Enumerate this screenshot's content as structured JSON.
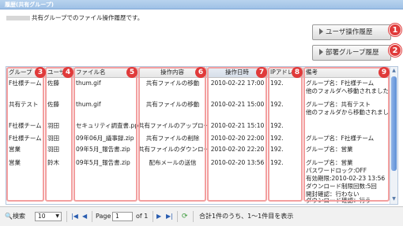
{
  "title": "履歴(共有グループ)",
  "description": "共有グループでのファイル操作履歴です。",
  "buttons": {
    "user_history": "ユーザ操作履歴",
    "dept_history": "部署グループ履歴"
  },
  "badges": [
    "1",
    "2",
    "3",
    "4",
    "5",
    "6",
    "7",
    "8",
    "9"
  ],
  "columns": [
    "グループ",
    "ユーザ",
    "ファイル名",
    "操作内容",
    "操作日時",
    "IPアドレス",
    "備考"
  ],
  "rows": [
    {
      "group": "F社様チーム",
      "user": "佐藤",
      "file": "thum.gif",
      "op": "共有ファイルの移動",
      "time": "2010-02-22 17:00",
      "ip": "192.",
      "note": [
        "グループ名：F社様チーム",
        "他のフォルダへ移動されました。"
      ]
    },
    {
      "group": "共有テスト",
      "user": "佐藤",
      "file": "thum.gif",
      "op": "共有ファイルの移動",
      "time": "2010-02-21 15:00",
      "ip": "192.",
      "note": [
        "グループ名：共有テスト",
        "他のフォルダから移動されました。"
      ]
    },
    {
      "group": "F社様チーム",
      "user": "羽田",
      "file": "セキュリティ調査書.ppt",
      "op": "共有ファイルのアップロード",
      "time": "2010-02-21 15:10",
      "ip": "192.",
      "note": []
    },
    {
      "group": "F社様チーム",
      "user": "羽田",
      "file": "09年06月_議事録.zip",
      "op": "共有ファイルの削除",
      "time": "2010-02-20 22:00",
      "ip": "192.",
      "note": [
        "グループ名：F社様チーム"
      ]
    },
    {
      "group": "営業",
      "user": "羽田",
      "file": "09年5月_報告書.zip",
      "op": "共有ファイルのダウンロード",
      "time": "2010-02-20 22:20",
      "ip": "192.",
      "note": [
        "グループ名：営業"
      ]
    },
    {
      "group": "営業",
      "user": "鈴木",
      "file": "09年5月_報告書.zip",
      "op": "配布メールの送信",
      "time": "2010-02-20 13:56",
      "ip": "192.",
      "note": [
        "グループ名：営業",
        "パスワードロック:OFF",
        "有効期限:2010-02-23 13:56",
        "ダウンロード制限回数:5回",
        "開封確認：行わない",
        "ダウンロード確認：行う"
      ]
    }
  ],
  "pager": {
    "search": "検索",
    "page_size": "10",
    "page_label": "Page",
    "page_value": "1",
    "of_label": "of 1",
    "summary": "合計1件のうち、1～1件目を表示"
  },
  "colors": {
    "accent": "#e03a3a",
    "title_bar": "#9fc1e6"
  }
}
